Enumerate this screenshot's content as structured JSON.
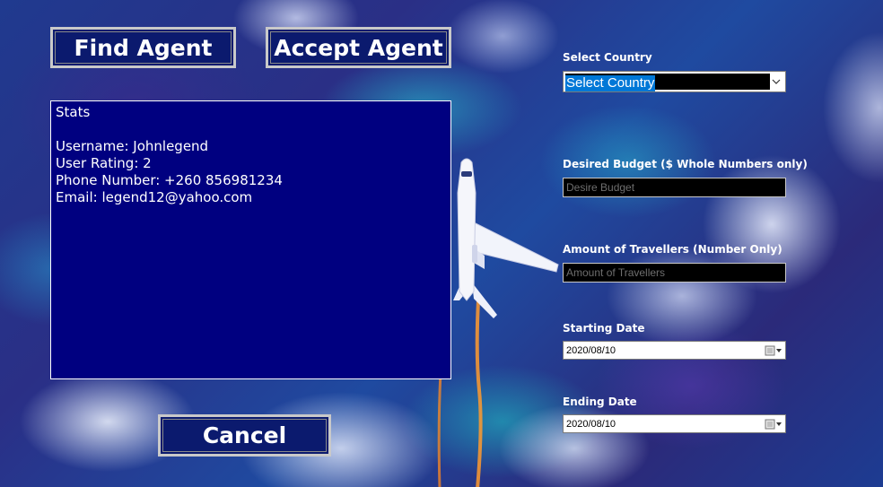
{
  "buttons": {
    "find_agent": "Find Agent",
    "accept_agent": "Accept Agent",
    "cancel": "Cancel"
  },
  "stats": {
    "lines": [
      "Stats",
      "",
      "Username: Johnlegend",
      "User Rating: 2",
      "Phone Number: +260 856981234",
      "Email: legend12@yahoo.com"
    ]
  },
  "form": {
    "country_label": "Select Country",
    "country_value": "Select Country",
    "budget_label": "Desired Budget ($ Whole Numbers only)",
    "budget_placeholder": "Desire Budget",
    "travellers_label": "Amount of Travellers (Number Only)",
    "travellers_placeholder": "Amount of Travellers",
    "start_label": "Starting Date",
    "start_value": "2020/08/10",
    "end_label": "Ending Date",
    "end_value": "2020/08/10"
  },
  "icons": {
    "dropdown": "chevron-down-icon",
    "calendar": "calendar-icon"
  },
  "colors": {
    "panel_bg": "#000080",
    "button_bg": "#0b1a6e",
    "selection": "#0078d7"
  }
}
